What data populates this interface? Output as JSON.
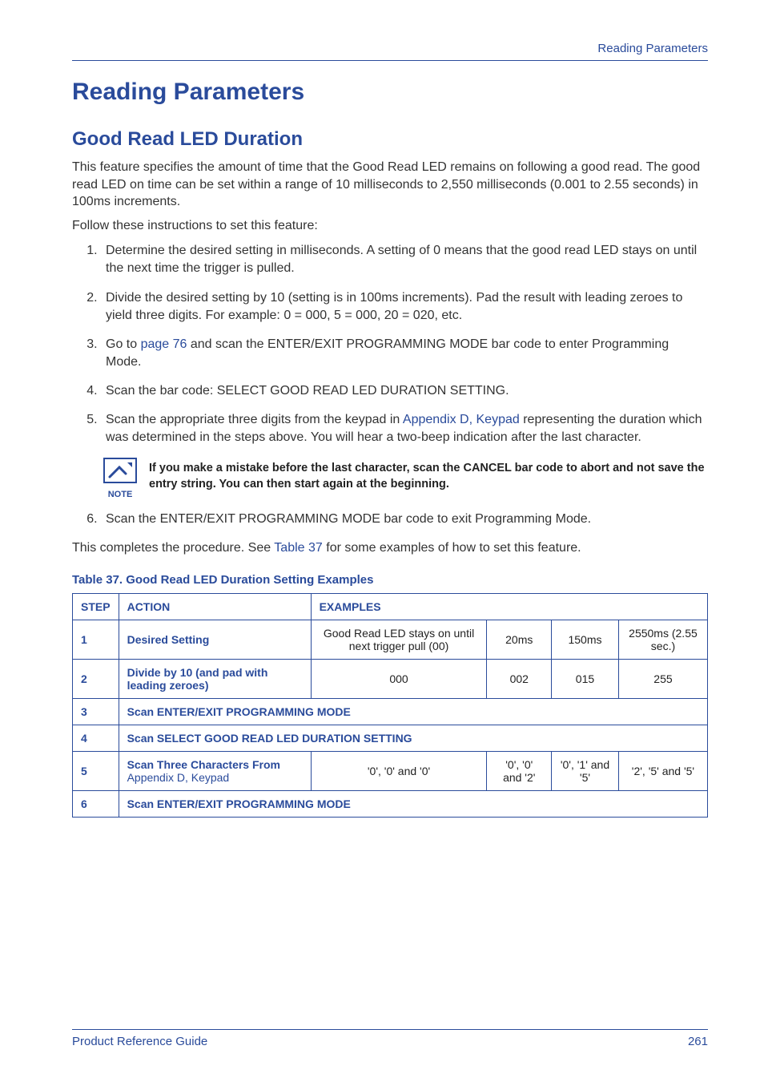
{
  "running_head": "Reading Parameters",
  "h1": "Reading Parameters",
  "h2": "Good Read LED Duration",
  "intro1": "This feature specifies the amount of time that the Good Read LED remains on following a good read. The good read LED on time can be set within a range of 10 milliseconds to 2,550 milliseconds (0.001 to 2.55 seconds) in 100ms increments.",
  "intro2": "Follow these instructions to set this feature:",
  "steps": {
    "s1": "Determine the desired setting in milliseconds. A setting of 0 means that the good read LED stays on until the next time the trigger is pulled.",
    "s2": "Divide the desired setting by 10 (setting is in 100ms increments). Pad the result with leading zeroes to yield three digits. For example: 0 = 000, 5 = 000, 20 = 020, etc.",
    "s3a": "Go to ",
    "s3_link": "page 76",
    "s3b": " and scan the ENTER/EXIT PROGRAMMING MODE bar code to enter Programming Mode.",
    "s4": "Scan the bar code: SELECT GOOD READ LED DURATION SETTING.",
    "s5a": "Scan the appropriate three digits from the keypad in ",
    "s5_link": "Appendix D, Keypad",
    "s5b": " representing the duration which was determined in the steps above. You will hear a two-beep indication after the last character.",
    "s6": "Scan the ENTER/EXIT PROGRAMMING MODE bar code to exit Programming Mode."
  },
  "note": {
    "label": "NOTE",
    "text": "If you make a mistake before the last character, scan the CANCEL bar code to abort and not save the entry string. You can then start again at the beginning."
  },
  "closing_a": "This completes the procedure. See ",
  "closing_link": "Table 37",
  "closing_b": " for some examples of how to set this feature.",
  "table": {
    "caption": "Table 37. Good Read LED Duration Setting Examples",
    "head_step": "STEP",
    "head_action": "ACTION",
    "head_examples": "EXAMPLES",
    "rows": {
      "r1": {
        "step": "1",
        "action": "Desired Setting",
        "c1": "Good Read LED stays on until next trigger pull (00)",
        "c2": "20ms",
        "c3": "150ms",
        "c4": "2550ms (2.55 sec.)"
      },
      "r2": {
        "step": "2",
        "action": "Divide by 10 (and pad with leading zeroes)",
        "c1": "000",
        "c2": "002",
        "c3": "015",
        "c4": "255"
      },
      "r3": {
        "step": "3",
        "merged": "Scan ENTER/EXIT PROGRAMMING MODE"
      },
      "r4": {
        "step": "4",
        "merged": "Scan SELECT GOOD READ LED DURATION SETTING"
      },
      "r5": {
        "step": "5",
        "action_a": "Scan Three Characters From ",
        "action_link": "Appendix D, Keypad",
        "c1": "'0', '0' and '0'",
        "c2": "'0', '0' and '2'",
        "c3": "'0', '1' and '5'",
        "c4": "'2', '5' and '5'"
      },
      "r6": {
        "step": "6",
        "merged": "Scan ENTER/EXIT PROGRAMMING MODE"
      }
    }
  },
  "footer": {
    "left": "Product Reference Guide",
    "right": "261"
  }
}
